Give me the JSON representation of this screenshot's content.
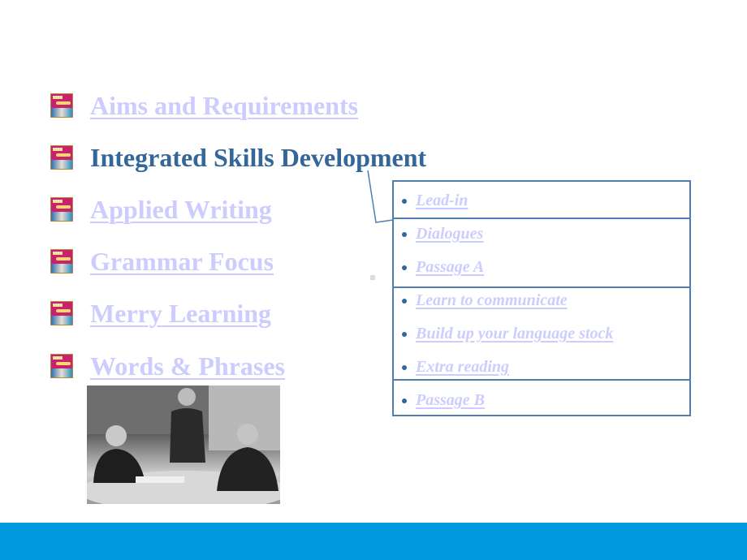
{
  "menu": [
    {
      "label": "Aims and Requirements",
      "active": false
    },
    {
      "label": "Integrated Skills Development",
      "active": true
    },
    {
      "label": "Applied Writing",
      "active": false
    },
    {
      "label": "Grammar Focus",
      "active": false
    },
    {
      "label": "Merry Learning",
      "active": false
    },
    {
      "label": "Words & Phrases",
      "active": false
    }
  ],
  "submenu": [
    "Lead-in",
    "Dialogues",
    "Passage A",
    "Learn to communicate",
    "Build up your language stock",
    "Extra reading",
    "Passage B"
  ],
  "colors": {
    "active": "#336699",
    "link": "#ccccff",
    "footer": "#0099e0",
    "border": "#4f7fb0"
  }
}
